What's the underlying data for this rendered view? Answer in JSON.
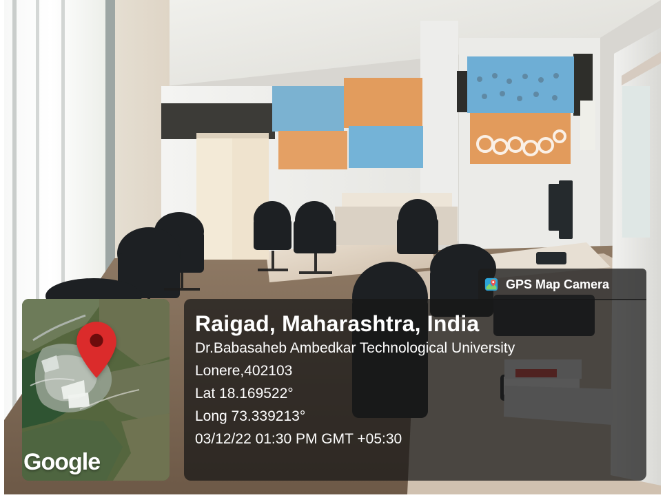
{
  "overlay": {
    "app_badge_label": "GPS Map Camera",
    "location_title": "Raigad, Maharashtra, India",
    "address_line_1": "Dr.Babasaheb Ambedkar Technological University",
    "address_line_2": "Lonere,402103",
    "latitude_text": "Lat 18.169522°",
    "longitude_text": "Long 73.339213°",
    "timestamp_text": "03/12/22 01:30 PM GMT +05:30"
  },
  "map": {
    "watermark": "Google",
    "pin_color": "#db2b2b",
    "pin_center_color": "#6d0c0c"
  },
  "icons": {
    "badge_icon": "map-camera-icon",
    "map_pin": "location-pin-icon"
  }
}
